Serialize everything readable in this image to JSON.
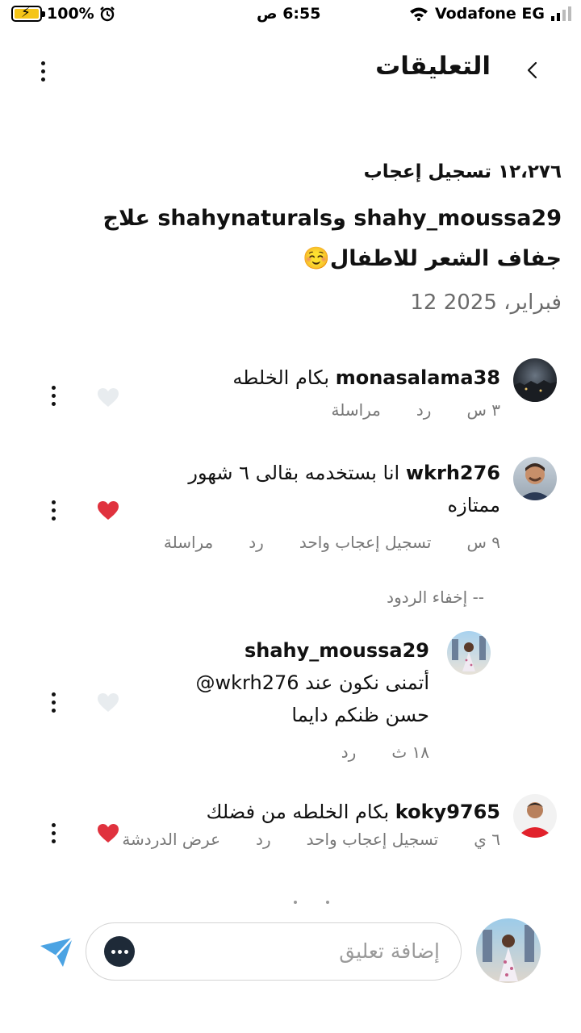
{
  "status_bar": {
    "battery": "100%",
    "time": "6:55 ص",
    "carrier": "Vodafone EG"
  },
  "header": {
    "title": "التعليقات"
  },
  "post": {
    "likes": "١٢،٢٧٦ تسجيل إعجاب",
    "caption_line1": "shahy_moussa29 وshahynaturals علاج",
    "caption_line2": "جفاف الشعر للاطفال☺️",
    "date": "12 فبراير، 2025"
  },
  "comments": [
    {
      "username": "monasalama38",
      "text": "بكام الخلطه",
      "text2": "",
      "time": "٣ س",
      "reply": "رد",
      "message": "مراسلة",
      "likes": "",
      "liked": false
    },
    {
      "username": "wkrh276",
      "text": "انا بستخدمه بقالى ٦ شهور",
      "text2": "ممتازه",
      "time": "٩ س",
      "likes": "تسجيل إعجاب واحد",
      "reply": "رد",
      "message": "مراسلة",
      "liked": true
    },
    {
      "username": "shahy_moussa29",
      "mention": "@wkrh276",
      "text": "أتمنى نكون عند",
      "text2": "حسن ظنكم دايما",
      "time": "١٨ ث",
      "reply": "رد",
      "liked": false
    },
    {
      "username": "koky9765",
      "text": "بكام الخلطه من فضلك",
      "time": "٦ ي",
      "likes": "تسجيل إعجاب واحد",
      "reply": "رد",
      "message": "عرض الدردشة",
      "liked": true
    }
  ],
  "hide_replies": "-- إخفاء الردود",
  "input": {
    "placeholder": "إضافة تعليق"
  },
  "colors": {
    "heart_red": "#e0323e",
    "heart_empty": "#e8ecef",
    "send_blue": "#4ba3e3",
    "meta_gray": "#777777"
  }
}
